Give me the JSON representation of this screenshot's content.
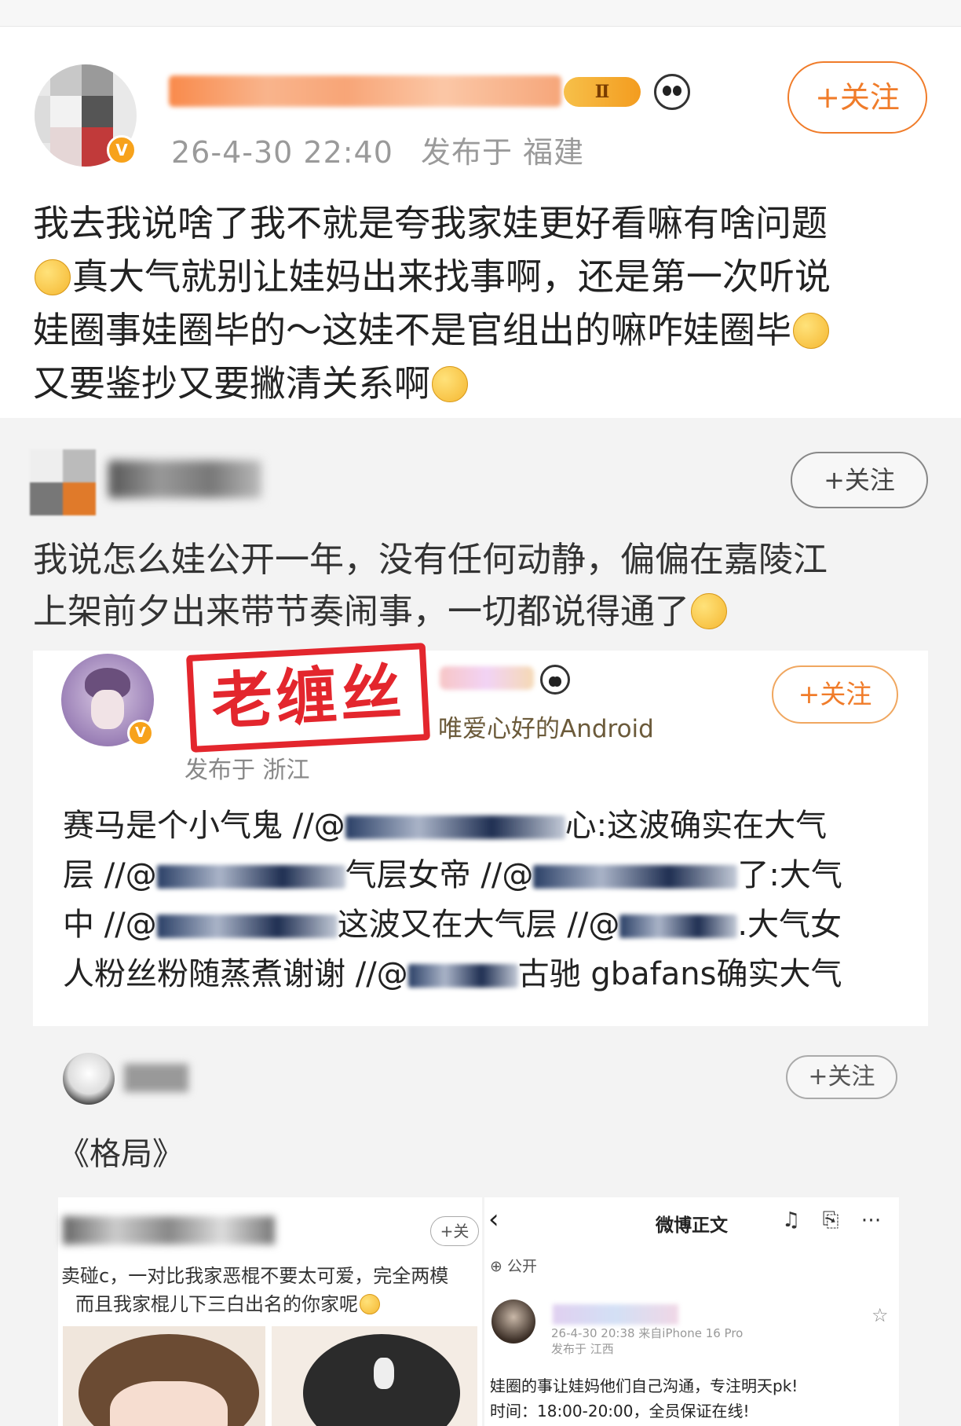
{
  "main_post": {
    "timestamp": "26-4-30 22:40",
    "location": "发布于 福建",
    "level_badge": "Ⅱ",
    "follow_label": "+关注",
    "text_lines": [
      "我去我说啥了我不就是夸我家娃更好看嘛有啥问题",
      "真大气就别让娃妈出来找事啊，还是第一次听说",
      "娃圈事娃圈毕的～这娃不是官组出的嘛咋娃圈毕",
      "又要鉴抄又要撇清关系啊"
    ]
  },
  "retweet": {
    "follow_label": "+关注",
    "text_lines": [
      "我说怎么娃公开一年，没有任何动静，偏偏在嘉陵江",
      "上架前夕出来带节奏闹事，一切都说得通了"
    ]
  },
  "embedded_post": {
    "stamp_text": "老缠丝",
    "source": "唯爱心好的Android",
    "location": "发布于 浙江",
    "follow_label": "+关注",
    "text_segments": {
      "l1a": "赛马是个小气鬼 //@",
      "l1b": "心:这波确实在大气",
      "l2a": "层 //@",
      "l2b": "气层女帝 //@",
      "l2c": "了:大气",
      "l3a": "中 //@",
      "l3b": "这波又在大气层 //@",
      "l3c": ".大气女",
      "l4a": "人粉丝粉随蒸煮谢谢 //@",
      "l4b": "古驰 gbafans确实大气"
    }
  },
  "third_card": {
    "follow_label": "+关注",
    "text": "《格局》"
  },
  "screenshot_left": {
    "follow_label": "+关",
    "line1": "卖碰c，一对比我家恶棍不要太可爱，完全两模",
    "line2": "而且我家棍儿下三白出名的你家呢"
  },
  "screenshot_right": {
    "back": "‹",
    "title": "微博正文",
    "icons": "♫ ⎘ ⋯",
    "visibility": "公开",
    "meta1": "26-4-30 20:38  来自iPhone 16 Pro",
    "meta2": "发布于 江西",
    "star": "☆",
    "line1": "娃圈的事让娃妈他们自己沟通，专注明天pk!",
    "line2": "时间：18:00-20:00，全员保证在线!"
  },
  "colors": {
    "accent_orange": "#f07c2a",
    "verified_badge": "#f7a21b",
    "stamp_red": "#e3262d",
    "feed_grey": "#f3f3f3"
  },
  "icons": [
    "panda-icon",
    "verified-icon",
    "emoji-icon",
    "back-icon",
    "star-icon"
  ]
}
